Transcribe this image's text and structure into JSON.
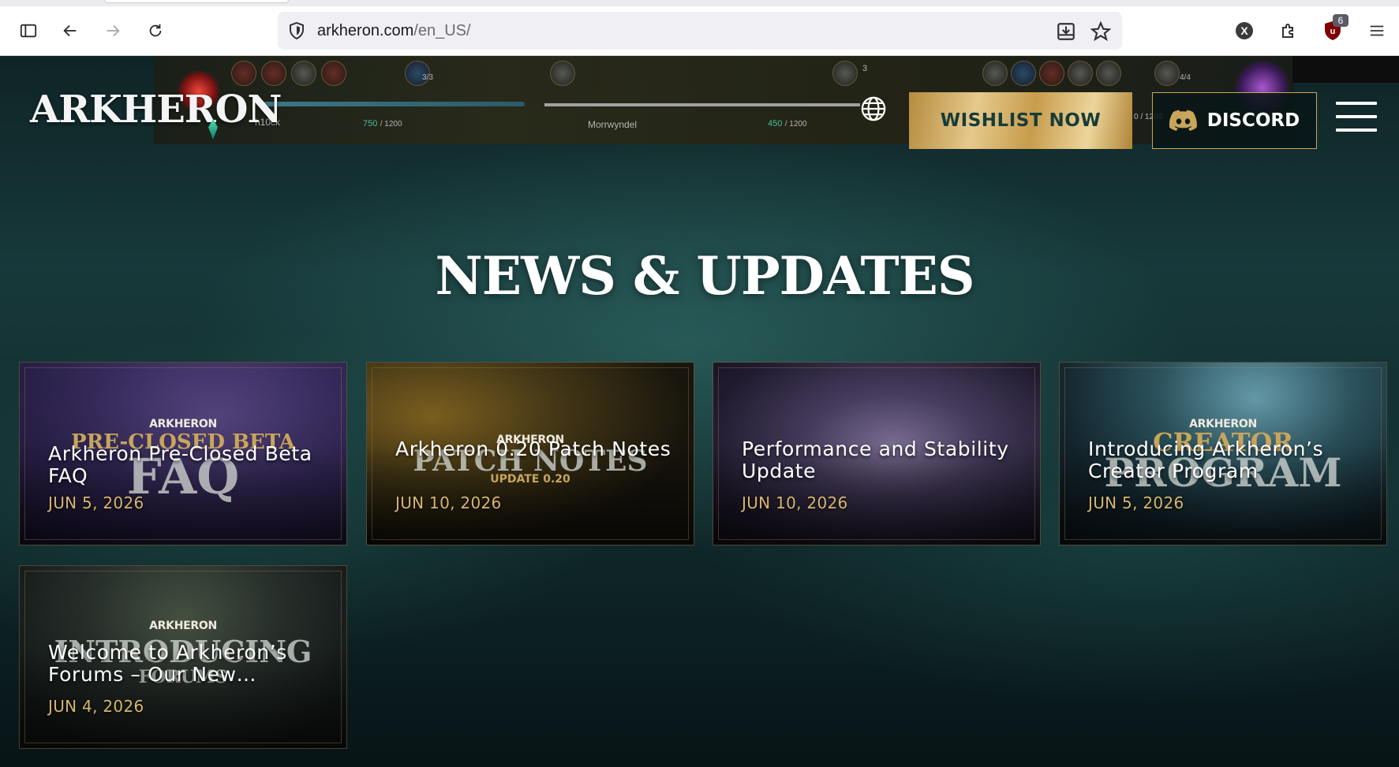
{
  "browser": {
    "url_host": "arkheron.com",
    "url_path": "/en_US/",
    "ublock_badge": "6",
    "extension_x_label": "X"
  },
  "site": {
    "logo_text": "ARKHERON",
    "wishlist_label": "WISHLIST NOW",
    "discord_label": "DISCORD",
    "hud": {
      "left_value": "750",
      "left_max": "/ 1200",
      "right_value": "450",
      "right_max": "/ 1200",
      "zone": "Morrwyndel",
      "count_left": "3/3",
      "count_right": "4/4",
      "count_mid": "3",
      "player_fragment": "h10ck",
      "edge_fragment": "0 / 1200"
    }
  },
  "news": {
    "heading": "NEWS & UPDATES",
    "cards": [
      {
        "brand": "ARKHERON",
        "art_line1": "PRE-CLOSED BETA",
        "art_line2": "FAQ",
        "title": "Arkheron Pre-Closed Beta FAQ",
        "date": "JUN 5, 2026"
      },
      {
        "brand": "ARKHERON",
        "art_line1": "PATCH NOTES",
        "art_line2": "UPDATE 0.20",
        "title": "Arkheron 0.20 Patch Notes",
        "date": "JUN 10, 2026"
      },
      {
        "title": "Performance and Stability Update",
        "date": "JUN 10, 2026"
      },
      {
        "brand": "ARKHERON",
        "art_line1": "CREATOR",
        "art_line2": "PROGRAM",
        "title": "Introducing Arkheron’s Creator Program",
        "date": "JUN 5, 2026"
      },
      {
        "brand": "ARKHERON",
        "art_line1": "INTRODUCING",
        "art_line2": "FORUMS",
        "title": "Welcome to Arkheron’s Forums – Our New…",
        "date": "JUN 4, 2026"
      }
    ]
  }
}
